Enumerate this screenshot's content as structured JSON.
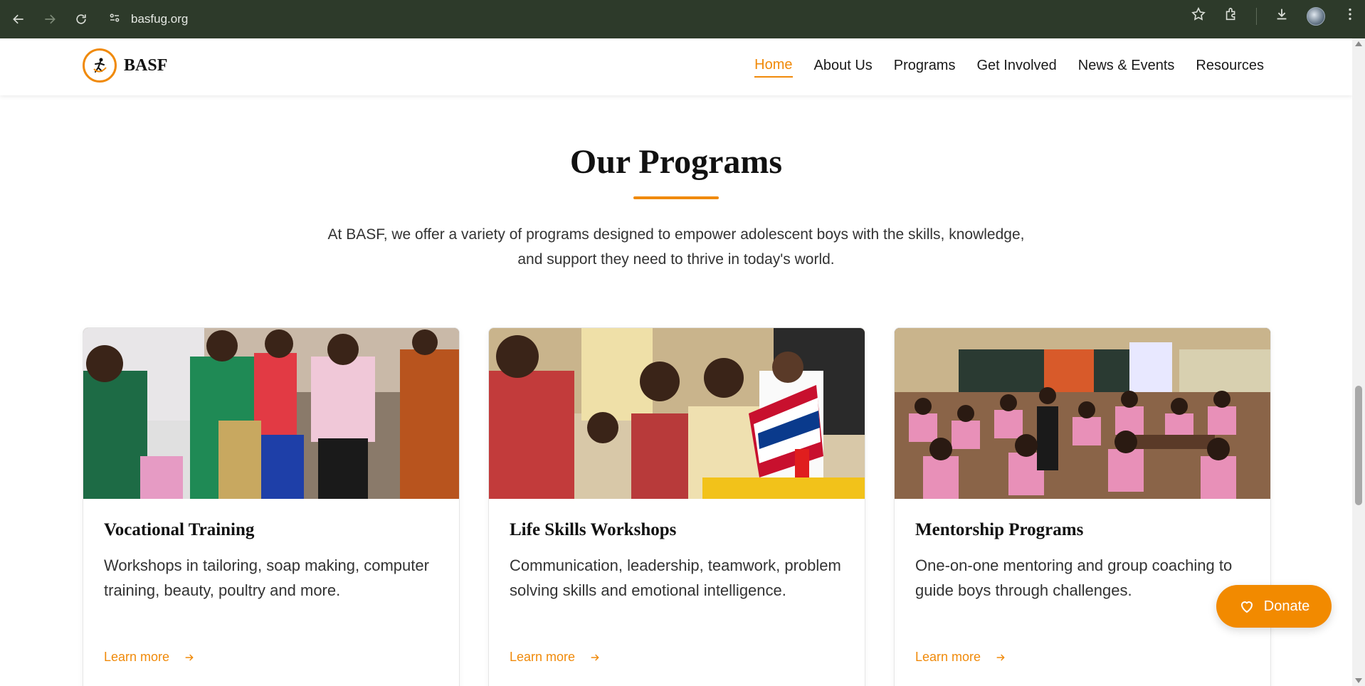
{
  "browser": {
    "url": "basfug.org",
    "icons": [
      "back-arrow-icon",
      "forward-arrow-icon",
      "reload-icon",
      "site-info-icon",
      "star-icon",
      "extensions-icon",
      "download-icon",
      "profile-avatar",
      "menu-dots-icon"
    ]
  },
  "header": {
    "logo_text": "BASF",
    "nav": [
      {
        "label": "Home",
        "active": true
      },
      {
        "label": "About Us",
        "active": false
      },
      {
        "label": "Programs",
        "active": false
      },
      {
        "label": "Get Involved",
        "active": false
      },
      {
        "label": "News & Events",
        "active": false
      },
      {
        "label": "Resources",
        "active": false
      }
    ]
  },
  "section": {
    "title": "Our Programs",
    "description": "At BASF, we offer a variety of programs designed to empower adolescent boys with the skills, knowledge, and support they need to thrive in today's world."
  },
  "cards": [
    {
      "title": "Vocational Training",
      "text": "Workshops in tailoring, soap making, computer training, beauty, poultry and more.",
      "link": "Learn more"
    },
    {
      "title": "Life Skills Workshops",
      "text": "Communication, leadership, teamwork, problem solving skills and emotional intelligence.",
      "link": "Learn more"
    },
    {
      "title": "Mentorship Programs",
      "text": "One-on-one mentoring and group coaching to guide boys through challenges.",
      "link": "Learn more"
    }
  ],
  "donate": {
    "label": "Donate"
  },
  "colors": {
    "accent": "#f08a0a",
    "chrome": "#2d3a2a"
  }
}
